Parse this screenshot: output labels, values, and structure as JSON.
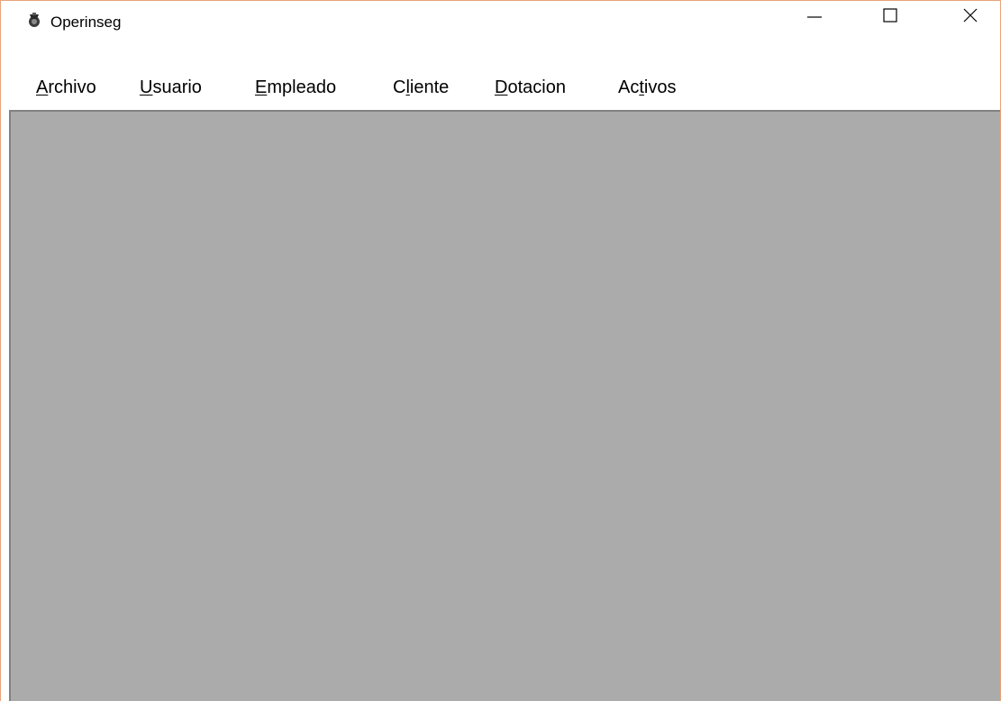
{
  "window": {
    "title": "Operinseg",
    "app_icon": "operinseg-app-icon",
    "controls": {
      "minimize_icon": "minimize-icon",
      "maximize_icon": "maximize-icon",
      "close_icon": "close-icon"
    },
    "border_color": "#e8a37a"
  },
  "menubar": {
    "items": [
      {
        "pre": "",
        "mnemonic": "A",
        "post": "rchivo"
      },
      {
        "pre": "",
        "mnemonic": "U",
        "post": "suario"
      },
      {
        "pre": "",
        "mnemonic": "E",
        "post": "mpleado"
      },
      {
        "pre": "C",
        "mnemonic": "l",
        "post": "iente"
      },
      {
        "pre": "",
        "mnemonic": "D",
        "post": "otacion"
      },
      {
        "pre": "Ac",
        "mnemonic": "t",
        "post": "ivos"
      }
    ]
  },
  "mdi_area": {
    "background_color": "#ababab"
  }
}
